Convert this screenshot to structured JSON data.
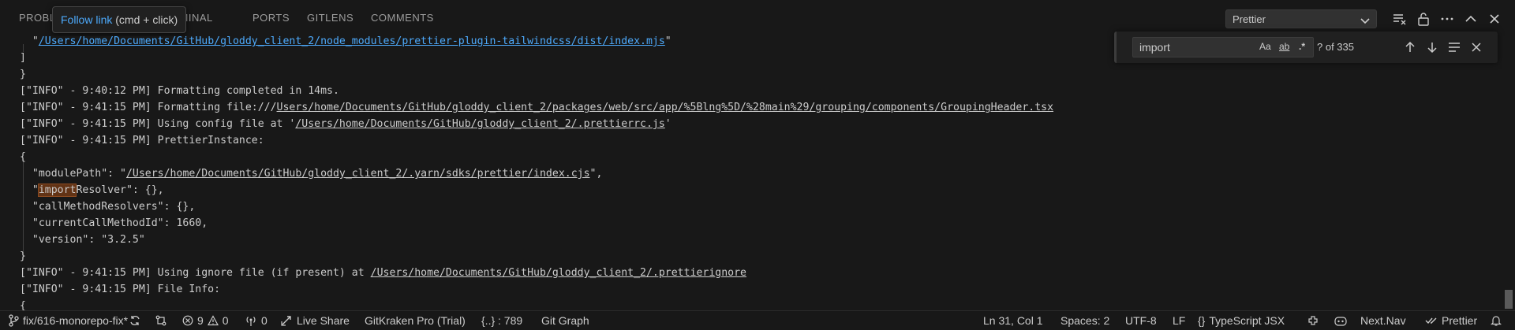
{
  "tabs": [
    "PROBLEMS",
    "TERMINAL",
    "PORTS",
    "GITLENS",
    "COMMENTS"
  ],
  "tooltip": {
    "link_text": "Follow link",
    "shortcut": "(cmd + click)"
  },
  "output_channel": {
    "selected": "Prettier"
  },
  "header_icons": [
    "clear-output-icon",
    "lock-scroll-icon",
    "more-actions-icon",
    "maximize-panel-icon",
    "close-panel-icon"
  ],
  "find": {
    "query": "import",
    "match_case": "Aa",
    "whole_word": "ab",
    "regex": ".*",
    "count": "? of 335"
  },
  "output_lines": {
    "l0_pre": "  \"",
    "l0_link": "/Users/home/Documents/GitHub/gloddy_client_2/node_modules/prettier-plugin-tailwindcss/dist/index.mjs",
    "l0_post": "\"",
    "l1": "]",
    "l2": "}",
    "l3": "[\"INFO\" - 9:40:12 PM] Formatting completed in 14ms.",
    "l4_pre": "[\"INFO\" - 9:41:15 PM] Formatting file:///",
    "l4_path": "Users/home/Documents/GitHub/gloddy_client_2/packages/web/src/app/%5Blng%5D/%28main%29/grouping/components/GroupingHeader.tsx",
    "l5_pre": "[\"INFO\" - 9:41:15 PM] Using config file at '",
    "l5_path": "/Users/home/Documents/GitHub/gloddy_client_2/.prettierrc.js",
    "l5_post": "'",
    "l6": "[\"INFO\" - 9:41:15 PM] PrettierInstance:",
    "l7": "{",
    "l8_pre": "  \"modulePath\": \"",
    "l8_path": "/Users/home/Documents/GitHub/gloddy_client_2/.yarn/sdks/prettier/index.cjs",
    "l8_post": "\",",
    "l9_pre": "  \"",
    "l9_match": "import",
    "l9_post": "Resolver\": {},",
    "l10": "  \"callMethodResolvers\": {},",
    "l11": "  \"currentCallMethodId\": 1660,",
    "l12": "  \"version\": \"3.2.5\"",
    "l13": "}",
    "l14_pre": "[\"INFO\" - 9:41:15 PM] Using ignore file (if present) at ",
    "l14_path": "/Users/home/Documents/GitHub/gloddy_client_2/.prettierignore",
    "l15": "[\"INFO\" - 9:41:15 PM] File Info:",
    "l16": "{"
  },
  "statusbar": {
    "branch": "fix/616-monorepo-fix*",
    "errors": "9",
    "warnings": "0",
    "ports": "0",
    "live_share": "Live Share",
    "gitkraken": "GitKraken Pro (Trial)",
    "bracket_count": "{..} : 789",
    "git_graph": "Git Graph",
    "position": "Ln 31, Col 1",
    "spaces": "Spaces: 2",
    "encoding": "UTF-8",
    "eol": "LF",
    "language": "TypeScript JSX",
    "nextnav": "Next.Nav",
    "prettier": "Prettier"
  }
}
